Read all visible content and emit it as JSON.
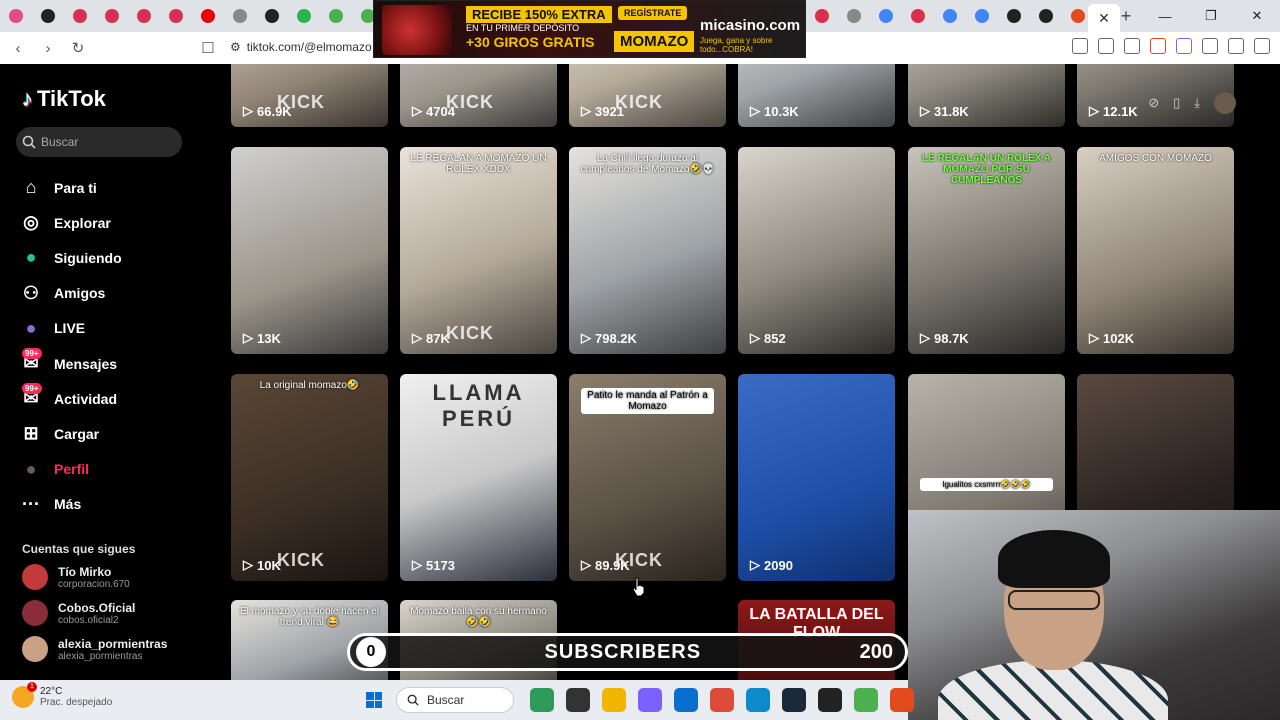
{
  "browser": {
    "url": "tiktok.com/@elmomazo",
    "tab_colors": [
      "#e24b86",
      "#222",
      "#d9304d",
      "#d9304d",
      "#d9304d",
      "#d9304d",
      "#e00",
      "#888",
      "#222",
      "#2bb24c",
      "#4caf50",
      "#4caf50"
    ],
    "right_tab_colors": [
      "#d9304d",
      "#888",
      "#4285f4",
      "#d9304d",
      "#4285f4",
      "#4285f4",
      "#222",
      "#222",
      "#e24b1d"
    ],
    "close_tab_icon": "close-icon",
    "new_tab_icon": "plus-icon"
  },
  "ad": {
    "line1": "RECIBE 150% EXTRA",
    "line2": "EN TU PRIMER DEPÓSITO",
    "line3": "+30 GIROS GRATIS",
    "cta": "REGÍSTRATE",
    "code": "MOMAZO",
    "brand": "micasino.com",
    "slogan": "Juega, gana y sobre todo...COBRA!"
  },
  "tiktok": {
    "logo": "TikTok",
    "search_placeholder": "Buscar",
    "nav": [
      {
        "label": "Para ti",
        "icon": "home-icon"
      },
      {
        "label": "Explorar",
        "icon": "compass-icon"
      },
      {
        "label": "Siguiendo",
        "icon": "following-avatar-icon"
      },
      {
        "label": "Amigos",
        "icon": "friends-icon"
      },
      {
        "label": "LIVE",
        "icon": "live-icon"
      },
      {
        "label": "Mensajes",
        "icon": "message-icon",
        "badge": "99+"
      },
      {
        "label": "Actividad",
        "icon": "activity-icon",
        "badge": "99+"
      },
      {
        "label": "Cargar",
        "icon": "upload-icon"
      },
      {
        "label": "Perfil",
        "icon": "profile-avatar-icon"
      },
      {
        "label": "Más",
        "icon": "more-icon"
      }
    ],
    "following_header": "Cuentas que sigues",
    "following": [
      {
        "name": "Tío Mirko",
        "handle": "corporacion.670"
      },
      {
        "name": "Cobos.Oficial",
        "handle": "cobos.oficial2"
      },
      {
        "name": "alexia_pormientras",
        "handle": "alexia_pormientras"
      }
    ]
  },
  "videos": {
    "row1": [
      {
        "count": "66.9K",
        "kick": "KICK"
      },
      {
        "count": "4704",
        "kick": "KICK"
      },
      {
        "count": "3921",
        "kick": "KICK"
      },
      {
        "count": "10.3K"
      },
      {
        "count": "31.8K"
      },
      {
        "count": "12.1K"
      }
    ],
    "row2": [
      {
        "count": "13K"
      },
      {
        "count": "87K",
        "caption": "LE REGALAN A MOMAZO UN ROLEX XDDX",
        "kick": "KICK"
      },
      {
        "count": "798.2K",
        "caption": "La Chili llega durazo al cumpleaños de Momazo🤣💀"
      },
      {
        "count": "852"
      },
      {
        "count": "98.7K",
        "caption": "LE REGALAN UN ROLEX A MOMAZO POR SU CUMPLEAÑOS"
      },
      {
        "count": "102K",
        "caption": "AMIGOS CON MOMAZO"
      }
    ],
    "row3": [
      {
        "count": "10K",
        "caption": "La original momazo🤣",
        "kick": "KICK"
      },
      {
        "count": "5173",
        "caption": "LLAMA PERÚ"
      },
      {
        "count": "89.9K",
        "caption": "Patito le manda al Patrón a Momazo",
        "kick": "KICK"
      },
      {
        "count": "2090"
      },
      {
        "count": "",
        "caption": "Igualitos cxsmrrr🤣🤣🤣"
      },
      {
        "count": ""
      }
    ],
    "row4": [
      {
        "caption": "El momazo y su doble hacen el trend viral 😂"
      },
      {
        "caption": "Momazo baila con su hermano 🤣🤣"
      },
      {},
      {
        "caption": "LA BATALLA DEL FLOW"
      }
    ]
  },
  "subscribers": {
    "min": "0",
    "label": "SUBSCRIBERS",
    "max": "200",
    "progress": 0
  },
  "taskbar": {
    "temperature": "22°C",
    "condition": "Prac. despejado",
    "weather_badge": "1",
    "search_placeholder": "Buscar",
    "app_colors": [
      "#2e9b5a",
      "#333",
      "#f2b600",
      "#7b61ff",
      "#0a6ed1",
      "#dd4b39",
      "#0c8ac9",
      "#1b2838",
      "#222",
      "#4caf50",
      "#e24b1d"
    ]
  }
}
